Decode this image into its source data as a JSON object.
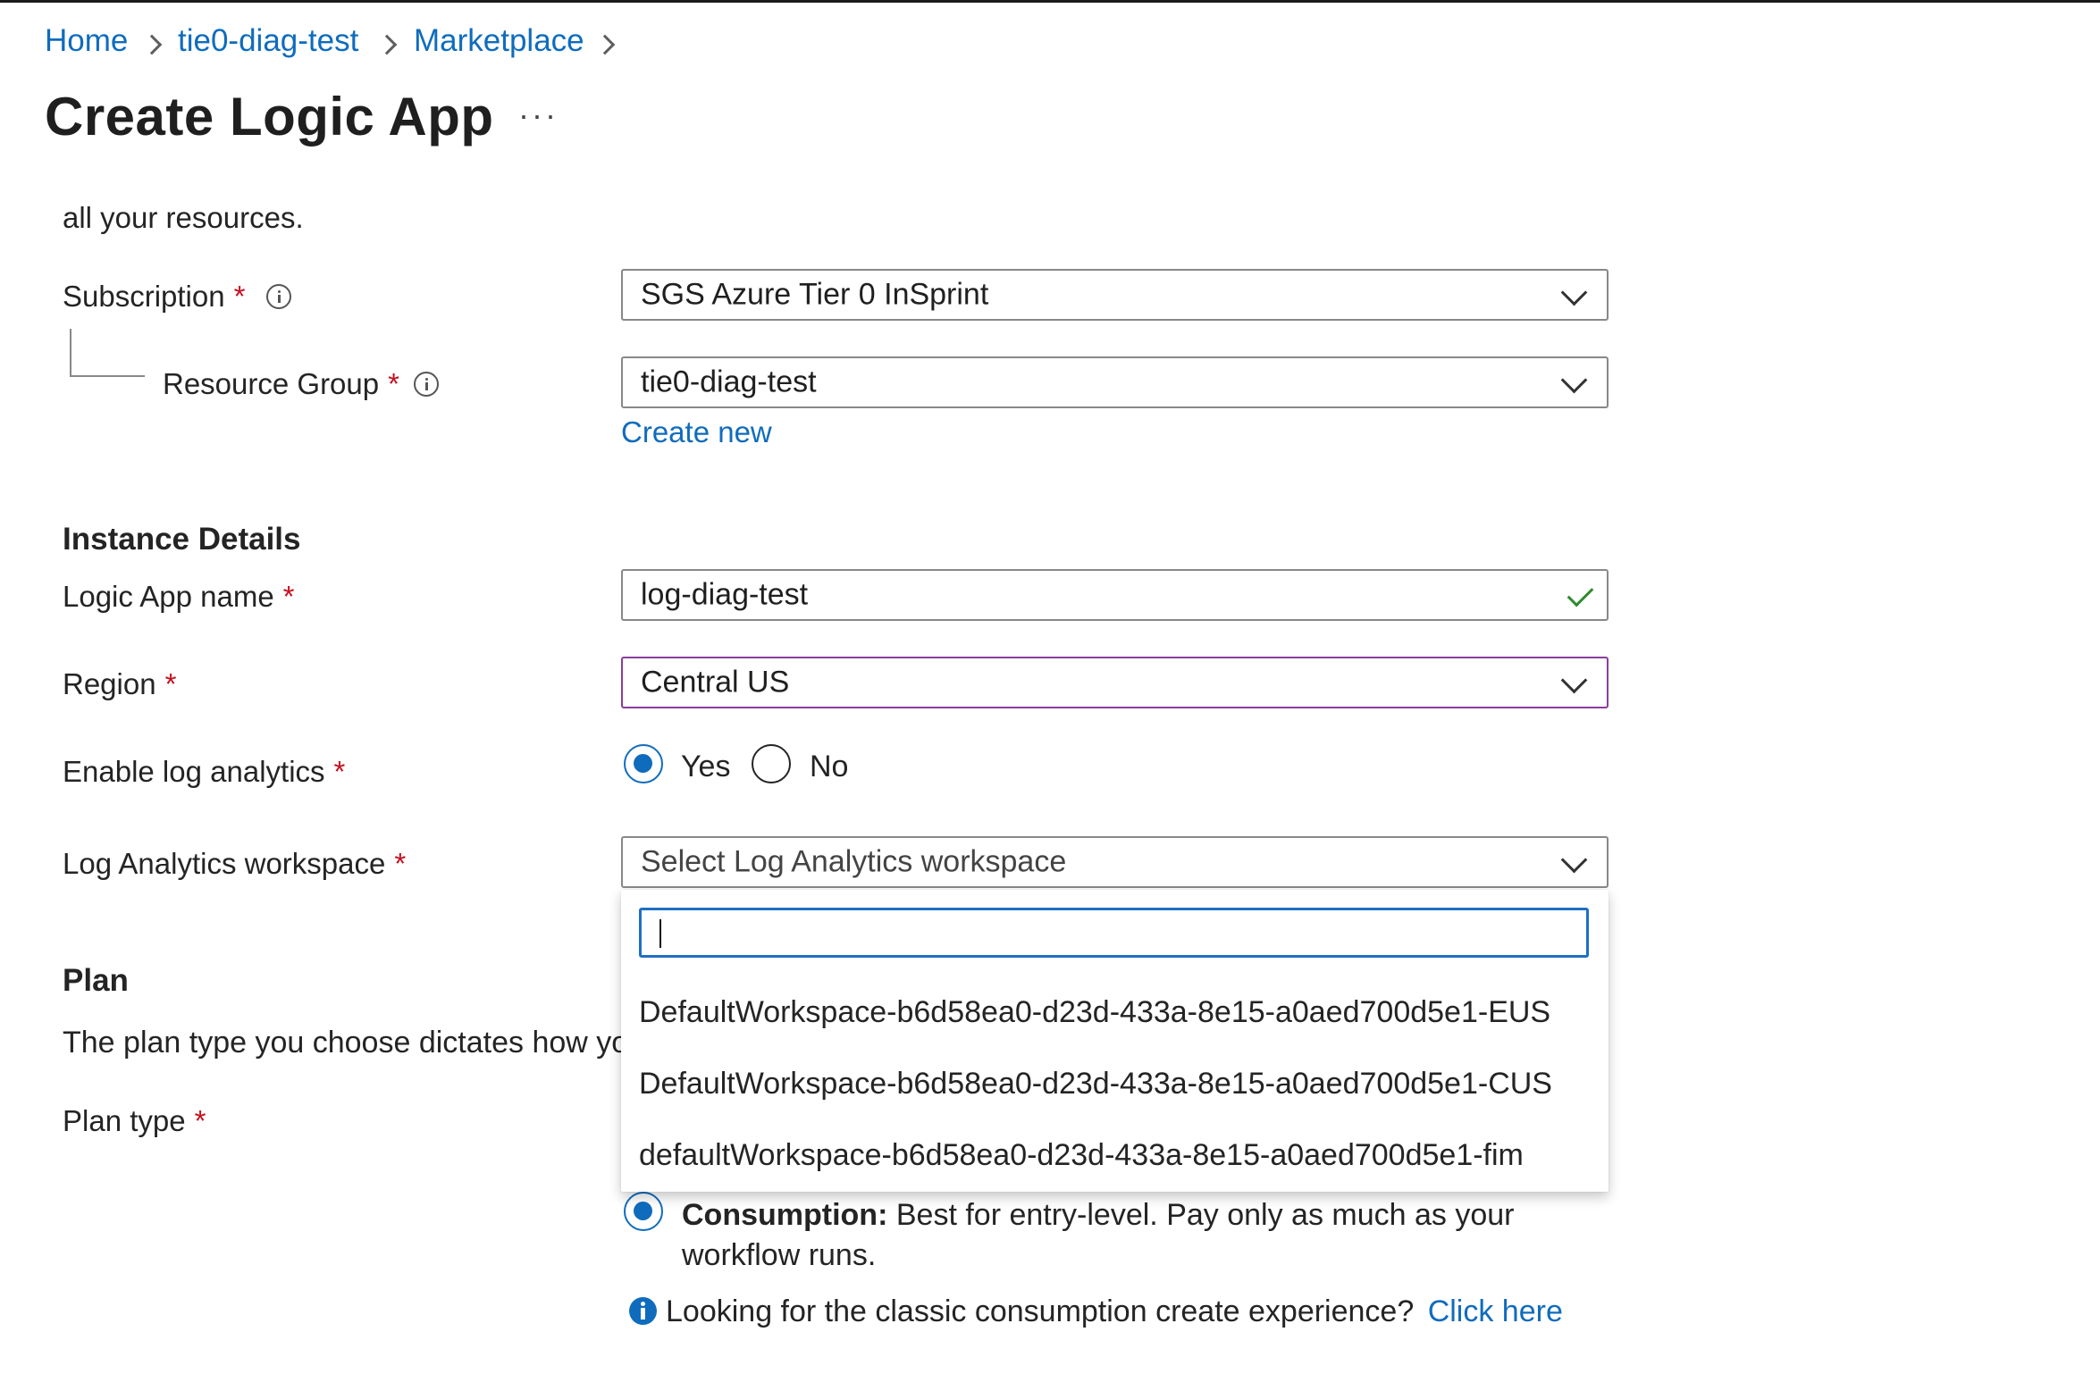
{
  "breadcrumb": {
    "items": [
      "Home",
      "tie0-diag-test",
      "Marketplace"
    ]
  },
  "page": {
    "title": "Create Logic App",
    "more_label": "···"
  },
  "intro_text": "all your resources.",
  "project": {
    "subscription_label": "Subscription",
    "subscription_value": "SGS Azure Tier 0 InSprint",
    "resource_group_label": "Resource Group",
    "resource_group_value": "tie0-diag-test",
    "create_new_label": "Create new"
  },
  "instance": {
    "heading": "Instance Details",
    "name_label": "Logic App name",
    "name_value": "log-diag-test",
    "region_label": "Region",
    "region_value": "Central US",
    "log_analytics_label": "Enable log analytics",
    "log_analytics_options": [
      "Yes",
      "No"
    ],
    "log_analytics_selected": "Yes",
    "workspace_label": "Log Analytics workspace",
    "workspace_placeholder": "Select Log Analytics workspace"
  },
  "workspace_dropdown": {
    "search_value": "",
    "options": [
      "DefaultWorkspace-b6d58ea0-d23d-433a-8e15-a0aed700d5e1-EUS",
      "DefaultWorkspace-b6d58ea0-d23d-433a-8e15-a0aed700d5e1-CUS",
      "defaultWorkspace-b6d58ea0-d23d-433a-8e15-a0aed700d5e1-fim"
    ]
  },
  "plan": {
    "heading": "Plan",
    "description": "The plan type you choose dictates how your",
    "type_label": "Plan type",
    "consumption_title": "Consumption:",
    "consumption_desc_line1": "Best for entry-level. Pay only as much as your",
    "consumption_desc_line2": "workflow runs.",
    "classic_text": "Looking for the classic consumption create experience?",
    "classic_link": "Click here"
  },
  "required_mark": "*",
  "colors": {
    "accent": "#0f6cbd",
    "required": "#c50f1f",
    "region_focus_border": "#8a3d9e",
    "valid_check": "#2e8b2e"
  },
  "icons": [
    "chevron-right-icon",
    "info-icon",
    "chevron-down-icon",
    "checkmark-icon",
    "info-filled-icon"
  ]
}
